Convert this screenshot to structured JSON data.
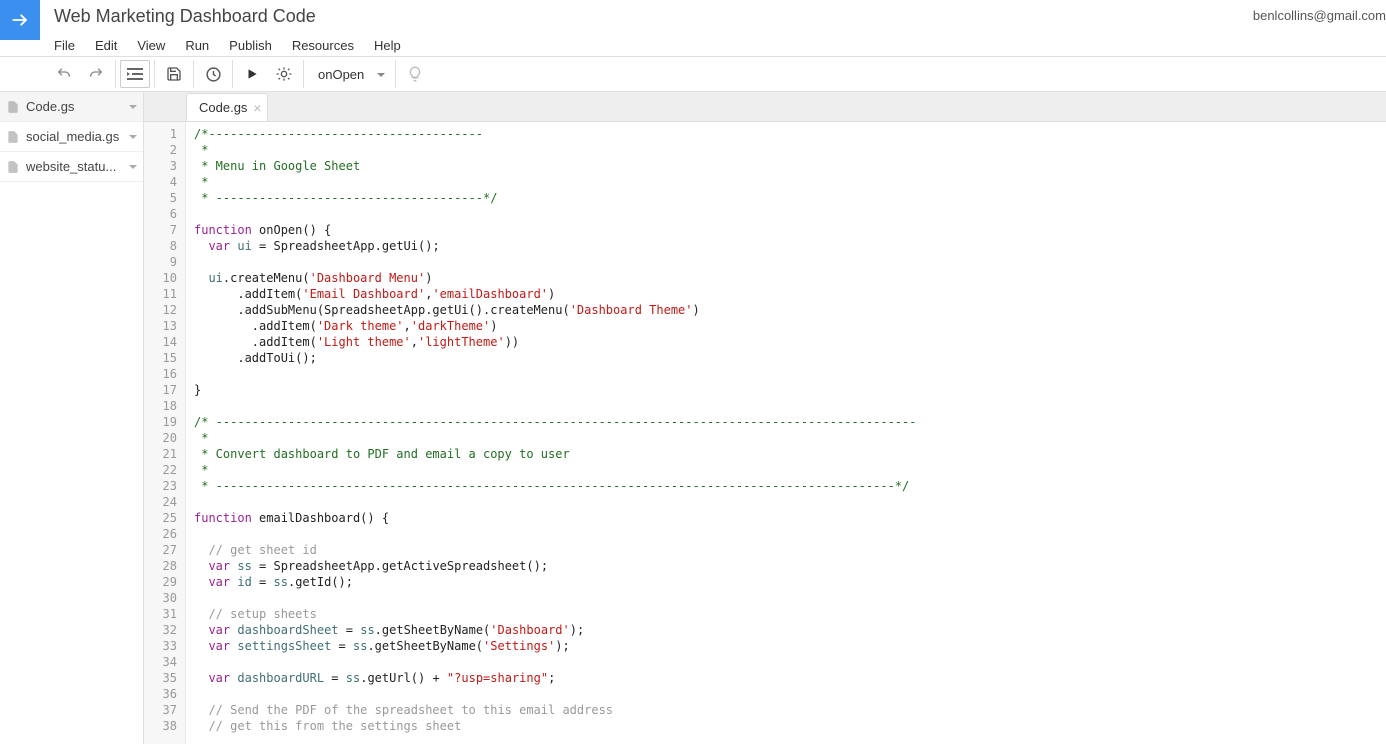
{
  "header": {
    "doc_title": "Web Marketing Dashboard Code",
    "user_email": "benlcollins@gmail.com",
    "menu": [
      "File",
      "Edit",
      "View",
      "Run",
      "Publish",
      "Resources",
      "Help"
    ]
  },
  "toolbar": {
    "function_selected": "onOpen"
  },
  "sidebar": {
    "files": [
      {
        "name": "Code.gs",
        "active": true
      },
      {
        "name": "social_media.gs",
        "active": false
      },
      {
        "name": "website_statu...",
        "active": false
      }
    ]
  },
  "tabs": [
    {
      "label": "Code.gs"
    }
  ],
  "code": {
    "lines": [
      {
        "n": 1,
        "segs": [
          {
            "t": "/*--------------------------------------",
            "c": "comment"
          }
        ]
      },
      {
        "n": 2,
        "segs": [
          {
            "t": " *",
            "c": "comment"
          }
        ]
      },
      {
        "n": 3,
        "segs": [
          {
            "t": " * Menu in Google Sheet",
            "c": "comment"
          }
        ]
      },
      {
        "n": 4,
        "segs": [
          {
            "t": " *",
            "c": "comment"
          }
        ]
      },
      {
        "n": 5,
        "segs": [
          {
            "t": " * -------------------------------------*/",
            "c": "comment"
          }
        ]
      },
      {
        "n": 6,
        "segs": []
      },
      {
        "n": 7,
        "segs": [
          {
            "t": "function",
            "c": "keyword"
          },
          {
            "t": " onOpen() {",
            "c": "plain"
          }
        ]
      },
      {
        "n": 8,
        "segs": [
          {
            "t": "  ",
            "c": "plain"
          },
          {
            "t": "var",
            "c": "keyword"
          },
          {
            "t": " ",
            "c": "plain"
          },
          {
            "t": "ui",
            "c": "ident"
          },
          {
            "t": " = SpreadsheetApp.getUi();",
            "c": "plain"
          }
        ]
      },
      {
        "n": 9,
        "segs": []
      },
      {
        "n": 10,
        "segs": [
          {
            "t": "  ",
            "c": "plain"
          },
          {
            "t": "ui",
            "c": "ident"
          },
          {
            "t": ".createMenu(",
            "c": "plain"
          },
          {
            "t": "'Dashboard Menu'",
            "c": "string"
          },
          {
            "t": ")",
            "c": "plain"
          }
        ]
      },
      {
        "n": 11,
        "segs": [
          {
            "t": "      .addItem(",
            "c": "plain"
          },
          {
            "t": "'Email Dashboard'",
            "c": "string"
          },
          {
            "t": ",",
            "c": "plain"
          },
          {
            "t": "'emailDashboard'",
            "c": "string"
          },
          {
            "t": ")",
            "c": "plain"
          }
        ]
      },
      {
        "n": 12,
        "segs": [
          {
            "t": "      .addSubMenu(SpreadsheetApp.getUi().createMenu(",
            "c": "plain"
          },
          {
            "t": "'Dashboard Theme'",
            "c": "string"
          },
          {
            "t": ")",
            "c": "plain"
          }
        ]
      },
      {
        "n": 13,
        "segs": [
          {
            "t": "        .addItem(",
            "c": "plain"
          },
          {
            "t": "'Dark theme'",
            "c": "string"
          },
          {
            "t": ",",
            "c": "plain"
          },
          {
            "t": "'darkTheme'",
            "c": "string"
          },
          {
            "t": ")",
            "c": "plain"
          }
        ]
      },
      {
        "n": 14,
        "segs": [
          {
            "t": "        .addItem(",
            "c": "plain"
          },
          {
            "t": "'Light theme'",
            "c": "string"
          },
          {
            "t": ",",
            "c": "plain"
          },
          {
            "t": "'lightTheme'",
            "c": "string"
          },
          {
            "t": "))",
            "c": "plain"
          }
        ]
      },
      {
        "n": 15,
        "segs": [
          {
            "t": "      .addToUi();",
            "c": "plain"
          }
        ]
      },
      {
        "n": 16,
        "segs": []
      },
      {
        "n": 17,
        "segs": [
          {
            "t": "}",
            "c": "plain"
          }
        ]
      },
      {
        "n": 18,
        "segs": []
      },
      {
        "n": 19,
        "segs": [
          {
            "t": "/* -------------------------------------------------------------------------------------------------",
            "c": "comment"
          }
        ]
      },
      {
        "n": 20,
        "segs": [
          {
            "t": " *",
            "c": "comment"
          }
        ]
      },
      {
        "n": 21,
        "segs": [
          {
            "t": " * Convert dashboard to PDF and email a copy to user",
            "c": "comment"
          }
        ]
      },
      {
        "n": 22,
        "segs": [
          {
            "t": " *",
            "c": "comment"
          }
        ]
      },
      {
        "n": 23,
        "segs": [
          {
            "t": " * ----------------------------------------------------------------------------------------------*/",
            "c": "comment"
          }
        ]
      },
      {
        "n": 24,
        "segs": []
      },
      {
        "n": 25,
        "segs": [
          {
            "t": "function",
            "c": "keyword"
          },
          {
            "t": " emailDashboard() {",
            "c": "plain"
          }
        ]
      },
      {
        "n": 26,
        "segs": []
      },
      {
        "n": 27,
        "segs": [
          {
            "t": "  ",
            "c": "plain"
          },
          {
            "t": "// get sheet id",
            "c": "comment-alt"
          }
        ]
      },
      {
        "n": 28,
        "segs": [
          {
            "t": "  ",
            "c": "plain"
          },
          {
            "t": "var",
            "c": "keyword"
          },
          {
            "t": " ",
            "c": "plain"
          },
          {
            "t": "ss",
            "c": "ident"
          },
          {
            "t": " = SpreadsheetApp.getActiveSpreadsheet();",
            "c": "plain"
          }
        ]
      },
      {
        "n": 29,
        "segs": [
          {
            "t": "  ",
            "c": "plain"
          },
          {
            "t": "var",
            "c": "keyword"
          },
          {
            "t": " ",
            "c": "plain"
          },
          {
            "t": "id",
            "c": "ident"
          },
          {
            "t": " = ",
            "c": "plain"
          },
          {
            "t": "ss",
            "c": "ident"
          },
          {
            "t": ".getId();",
            "c": "plain"
          }
        ]
      },
      {
        "n": 30,
        "segs": []
      },
      {
        "n": 31,
        "segs": [
          {
            "t": "  ",
            "c": "plain"
          },
          {
            "t": "// setup sheets",
            "c": "comment-alt"
          }
        ]
      },
      {
        "n": 32,
        "segs": [
          {
            "t": "  ",
            "c": "plain"
          },
          {
            "t": "var",
            "c": "keyword"
          },
          {
            "t": " ",
            "c": "plain"
          },
          {
            "t": "dashboardSheet",
            "c": "ident"
          },
          {
            "t": " = ",
            "c": "plain"
          },
          {
            "t": "ss",
            "c": "ident"
          },
          {
            "t": ".getSheetByName(",
            "c": "plain"
          },
          {
            "t": "'Dashboard'",
            "c": "string"
          },
          {
            "t": ");",
            "c": "plain"
          }
        ]
      },
      {
        "n": 33,
        "segs": [
          {
            "t": "  ",
            "c": "plain"
          },
          {
            "t": "var",
            "c": "keyword"
          },
          {
            "t": " ",
            "c": "plain"
          },
          {
            "t": "settingsSheet",
            "c": "ident"
          },
          {
            "t": " = ",
            "c": "plain"
          },
          {
            "t": "ss",
            "c": "ident"
          },
          {
            "t": ".getSheetByName(",
            "c": "plain"
          },
          {
            "t": "'Settings'",
            "c": "string"
          },
          {
            "t": ");",
            "c": "plain"
          }
        ]
      },
      {
        "n": 34,
        "segs": []
      },
      {
        "n": 35,
        "segs": [
          {
            "t": "  ",
            "c": "plain"
          },
          {
            "t": "var",
            "c": "keyword"
          },
          {
            "t": " ",
            "c": "plain"
          },
          {
            "t": "dashboardURL",
            "c": "ident"
          },
          {
            "t": " = ",
            "c": "plain"
          },
          {
            "t": "ss",
            "c": "ident"
          },
          {
            "t": ".getUrl() + ",
            "c": "plain"
          },
          {
            "t": "\"?usp=sharing\"",
            "c": "string"
          },
          {
            "t": ";",
            "c": "plain"
          }
        ]
      },
      {
        "n": 36,
        "segs": []
      },
      {
        "n": 37,
        "segs": [
          {
            "t": "  ",
            "c": "plain"
          },
          {
            "t": "// Send the PDF of the spreadsheet to this email address",
            "c": "comment-alt"
          }
        ]
      },
      {
        "n": 38,
        "segs": [
          {
            "t": "  ",
            "c": "plain"
          },
          {
            "t": "// get this from the settings sheet",
            "c": "comment-alt"
          }
        ]
      }
    ]
  }
}
